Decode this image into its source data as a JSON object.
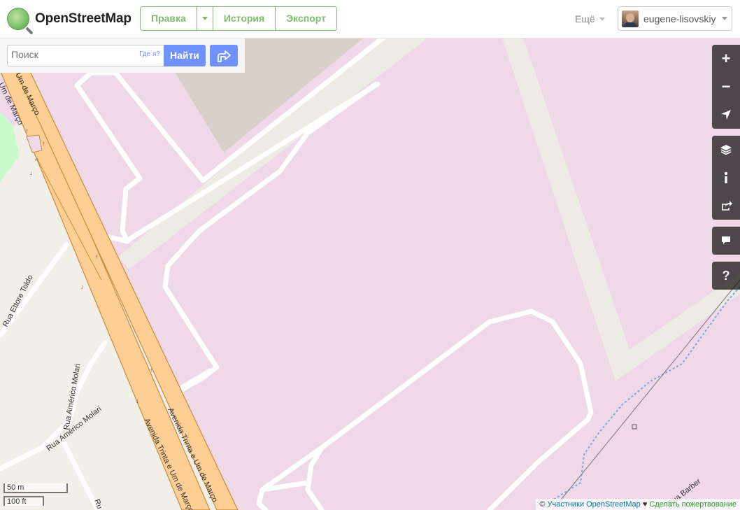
{
  "header": {
    "logo_text": "OpenStreetMap",
    "edit_label": "Правка",
    "history_label": "История",
    "export_label": "Экспорт",
    "more_label": "Ещё",
    "username": "eugene-lisovskiy"
  },
  "search": {
    "placeholder": "Поиск",
    "where_am_i": "Где я?",
    "submit_label": "Найти"
  },
  "controls": {
    "zoom_in": "+",
    "zoom_out": "−",
    "help": "?"
  },
  "map_labels": {
    "avenida_1": "Avenida Trinta e Um de Março",
    "avenida_2": "Avenida Trinta e Um de Março",
    "um_de_marco_1": "Um de Março",
    "um_de_marco_2": "Um de Março",
    "rua_ettore": "Rua Ettore Toldo",
    "rua_americo": "Rua Américo Molari",
    "rua_americo_2": "Rua Américo Molari",
    "rua_barber": "Rua Barber",
    "rua_cut": "Ru"
  },
  "scale": {
    "metric": "50 m",
    "imperial": "100 ft"
  },
  "attribution": {
    "copyright": "©",
    "contributors": "Участники OpenStreetMap",
    "heart": "♥",
    "donate": "Сделать пожертвование"
  },
  "colors": {
    "brand_green": "#7ebc6f",
    "search_blue": "#7092ff",
    "land_pink": "#efd9e9",
    "road_orange": "#fdcf95",
    "residential": "#f2efe9"
  }
}
